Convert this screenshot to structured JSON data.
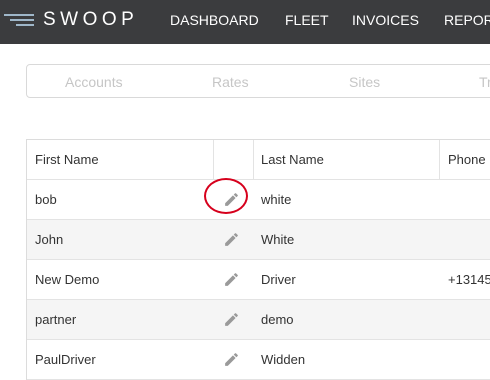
{
  "app": {
    "logo_text": "SWOOP"
  },
  "nav": {
    "items": [
      "DASHBOARD",
      "FLEET",
      "INVOICES",
      "REPORTS"
    ]
  },
  "tabs": [
    "Accounts",
    "Rates",
    "Sites",
    "Tr"
  ],
  "table": {
    "headers": {
      "first_name": "First Name",
      "last_name": "Last Name",
      "phone": "Phone"
    },
    "rows": [
      {
        "first_name": "bob",
        "last_name": "white",
        "phone": ""
      },
      {
        "first_name": "John",
        "last_name": "White",
        "phone": ""
      },
      {
        "first_name": "New Demo",
        "last_name": "Driver",
        "phone": "+13145"
      },
      {
        "first_name": "partner",
        "last_name": "demo",
        "phone": ""
      },
      {
        "first_name": "PaulDriver",
        "last_name": "Widden",
        "phone": ""
      }
    ],
    "edit_icon": "pencil-icon"
  },
  "colors": {
    "nav_bg": "#3b3c3e",
    "highlight": "#d6001c",
    "tab_text": "#c6c6c6"
  }
}
